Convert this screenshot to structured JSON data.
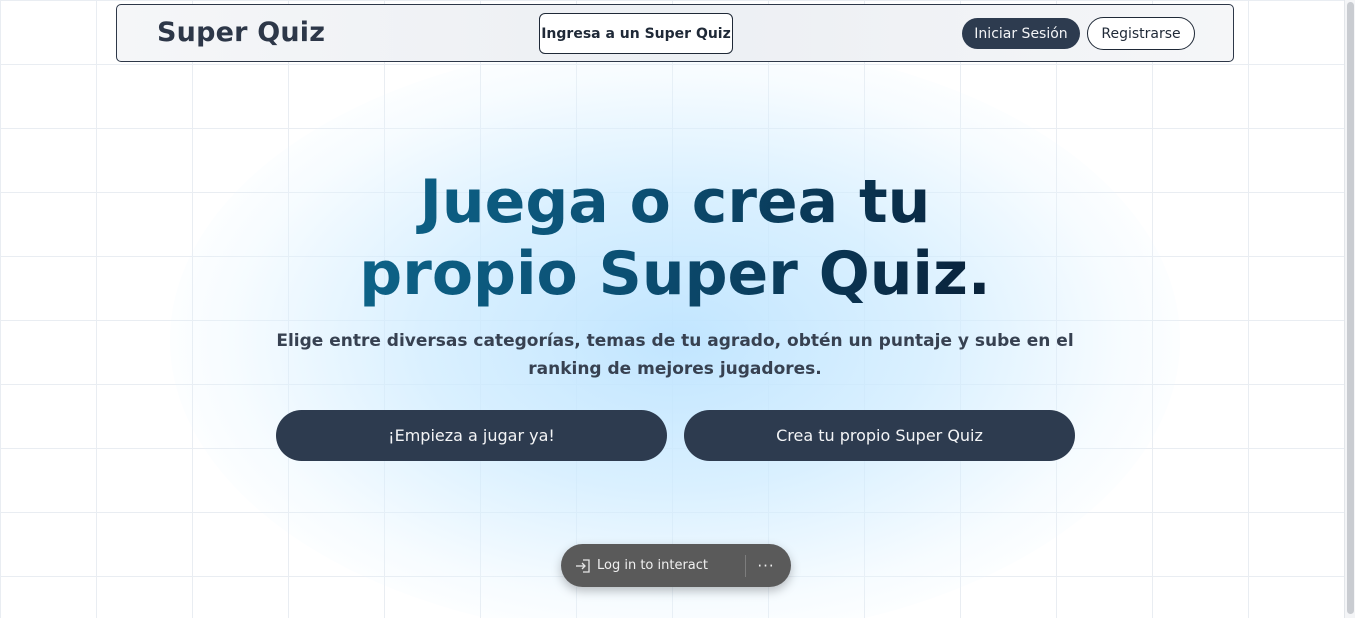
{
  "navbar": {
    "brand": "Super Quiz",
    "join_label": "Ingresa a un Super Quiz",
    "login_label": "Iniciar Sesión",
    "register_label": "Registrarse"
  },
  "hero": {
    "title_line1": "Juega o crea tu",
    "title_line2": "propio Super Quiz.",
    "subtitle_line1": "Elige entre diversas categorías, temas de tu agrado, obtén un puntaje y sube en el",
    "subtitle_line2": "ranking de mejores jugadores.",
    "cta_play": "¡Empieza a jugar ya!",
    "cta_create": "Crea tu propio Super Quiz"
  },
  "overlay": {
    "login_prompt": "Log in to interact",
    "more_label": "···",
    "login_icon": "login-icon",
    "more_icon": "more-icon"
  },
  "colors": {
    "button_dark": "#2d3b4f",
    "text_dark": "#2d3748",
    "title_gradient_start": "#0e6a8f",
    "title_gradient_end": "#0a1a2e",
    "glow": "#cde9ff"
  }
}
